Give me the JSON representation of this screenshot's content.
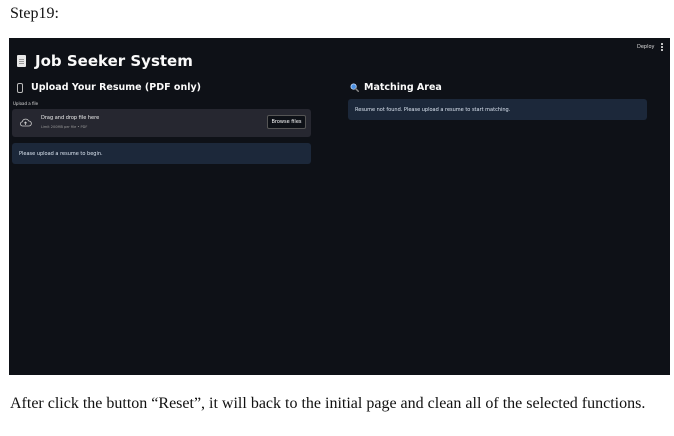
{
  "document": {
    "step_label": "Step19:",
    "caption": "After click the button “Reset”, it will back to the initial page and clean all of the selected functions."
  },
  "app": {
    "deploy_label": "Deploy",
    "title": "Job Seeker System",
    "upload_section": {
      "heading": "Upload Your Resume (PDF only)",
      "field_label": "Upload a file",
      "dropzone_text": "Drag and drop file here",
      "dropzone_limit": "Limit 200MB per file • PDF",
      "browse_label": "Browse files",
      "info_message": "Please upload a resume to begin."
    },
    "matching_section": {
      "heading": "Matching Area",
      "info_message": "Resume not found. Please upload a resume to start matching."
    }
  },
  "icons": [
    "document-icon",
    "paperclip-icon",
    "cloud-upload-icon",
    "magnifier-icon",
    "kebab-menu-icon"
  ],
  "colors": {
    "app_background": "#0e1117",
    "info_background": "#1c283a",
    "uploader_background": "#262730",
    "magnifier_blue": "#4a90e2"
  }
}
